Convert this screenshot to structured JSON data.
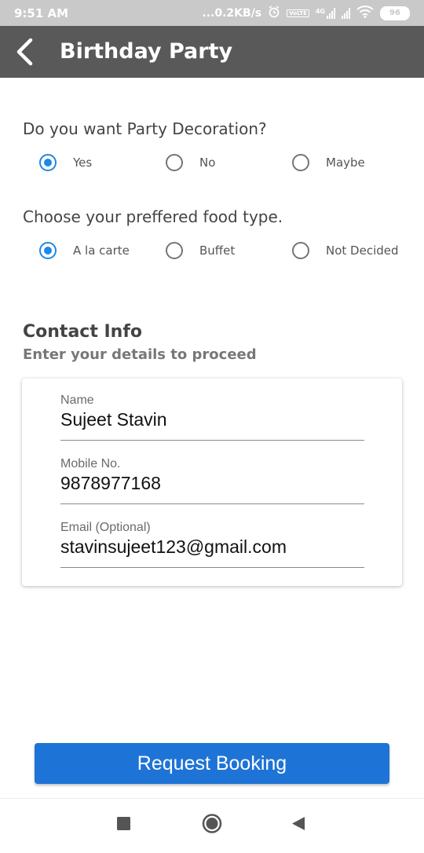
{
  "status_bar": {
    "time": "9:51 AM",
    "net_speed": "...0.2KB/s",
    "network_label": "4G",
    "volte_label": "VoLTE",
    "battery": "96",
    "icons": [
      "alarm-icon",
      "volte-icon",
      "signal-4g-icon",
      "signal-icon",
      "wifi-icon",
      "battery-icon"
    ]
  },
  "appbar": {
    "back_icon": "back-arrow-icon",
    "title": "Birthday Party"
  },
  "decoration": {
    "question": "Do you want Party Decoration?",
    "options": [
      "Yes",
      "No",
      "Maybe"
    ],
    "selected": "Yes"
  },
  "food": {
    "question": "Choose your preffered food type.",
    "options": [
      "A la carte",
      "Buffet",
      "Not Decided"
    ],
    "selected": "A la carte"
  },
  "contact": {
    "title": "Contact Info",
    "subtitle": "Enter your details to proceed",
    "fields": [
      {
        "label": "Name",
        "value": "Sujeet Stavin"
      },
      {
        "label": "Mobile No.",
        "value": "9878977168"
      },
      {
        "label": "Email (Optional)",
        "value": "stavinsujeet123@gmail.com"
      }
    ]
  },
  "request_button": "Request Booking",
  "nav": {
    "icons": [
      "recents-square-icon",
      "home-circle-icon",
      "back-triangle-icon"
    ]
  },
  "colors": {
    "accent": "#1e88e5",
    "button": "#1e74d6",
    "appbar": "#595959",
    "statusbar": "#c9c9c9"
  }
}
